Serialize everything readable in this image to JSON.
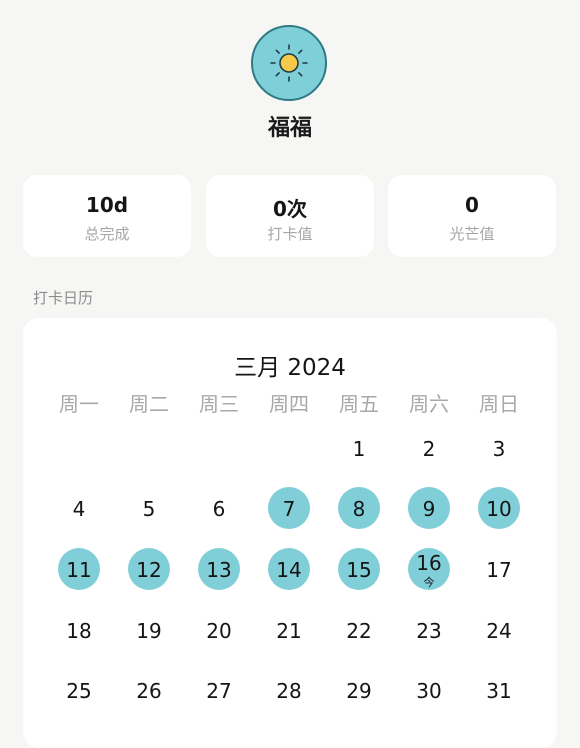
{
  "profile": {
    "avatar_icon": "sun-icon",
    "name": "福福"
  },
  "stats": [
    {
      "value": "10d",
      "label": "总完成"
    },
    {
      "value": "0次",
      "label": "打卡值"
    },
    {
      "value": "0",
      "label": "光芒值"
    }
  ],
  "section_title": "打卡日历",
  "calendar": {
    "month_title": "三月 2024",
    "weekdays": [
      "周一",
      "周二",
      "周三",
      "周四",
      "周五",
      "周六",
      "周日"
    ],
    "today_label": "今",
    "days": [
      {
        "num": "1",
        "checked": false,
        "today": false
      },
      {
        "num": "2",
        "checked": false,
        "today": false
      },
      {
        "num": "3",
        "checked": false,
        "today": false
      },
      {
        "num": "4",
        "checked": false,
        "today": false
      },
      {
        "num": "5",
        "checked": false,
        "today": false
      },
      {
        "num": "6",
        "checked": false,
        "today": false
      },
      {
        "num": "7",
        "checked": true,
        "today": false
      },
      {
        "num": "8",
        "checked": true,
        "today": false
      },
      {
        "num": "9",
        "checked": true,
        "today": false
      },
      {
        "num": "10",
        "checked": true,
        "today": false
      },
      {
        "num": "11",
        "checked": true,
        "today": false
      },
      {
        "num": "12",
        "checked": true,
        "today": false
      },
      {
        "num": "13",
        "checked": true,
        "today": false
      },
      {
        "num": "14",
        "checked": true,
        "today": false
      },
      {
        "num": "15",
        "checked": true,
        "today": false
      },
      {
        "num": "16",
        "checked": true,
        "today": true
      },
      {
        "num": "17",
        "checked": false,
        "today": false
      },
      {
        "num": "18",
        "checked": false,
        "today": false
      },
      {
        "num": "19",
        "checked": false,
        "today": false
      },
      {
        "num": "20",
        "checked": false,
        "today": false
      },
      {
        "num": "21",
        "checked": false,
        "today": false
      },
      {
        "num": "22",
        "checked": false,
        "today": false
      },
      {
        "num": "23",
        "checked": false,
        "today": false
      },
      {
        "num": "24",
        "checked": false,
        "today": false
      },
      {
        "num": "25",
        "checked": false,
        "today": false
      },
      {
        "num": "26",
        "checked": false,
        "today": false
      },
      {
        "num": "27",
        "checked": false,
        "today": false
      },
      {
        "num": "28",
        "checked": false,
        "today": false
      },
      {
        "num": "29",
        "checked": false,
        "today": false
      },
      {
        "num": "30",
        "checked": false,
        "today": false
      },
      {
        "num": "31",
        "checked": false,
        "today": false
      }
    ]
  },
  "colors": {
    "accent": "#80cfd8",
    "background": "#f6f6f4",
    "card": "#ffffff",
    "muted_text": "#a6a6a6"
  }
}
